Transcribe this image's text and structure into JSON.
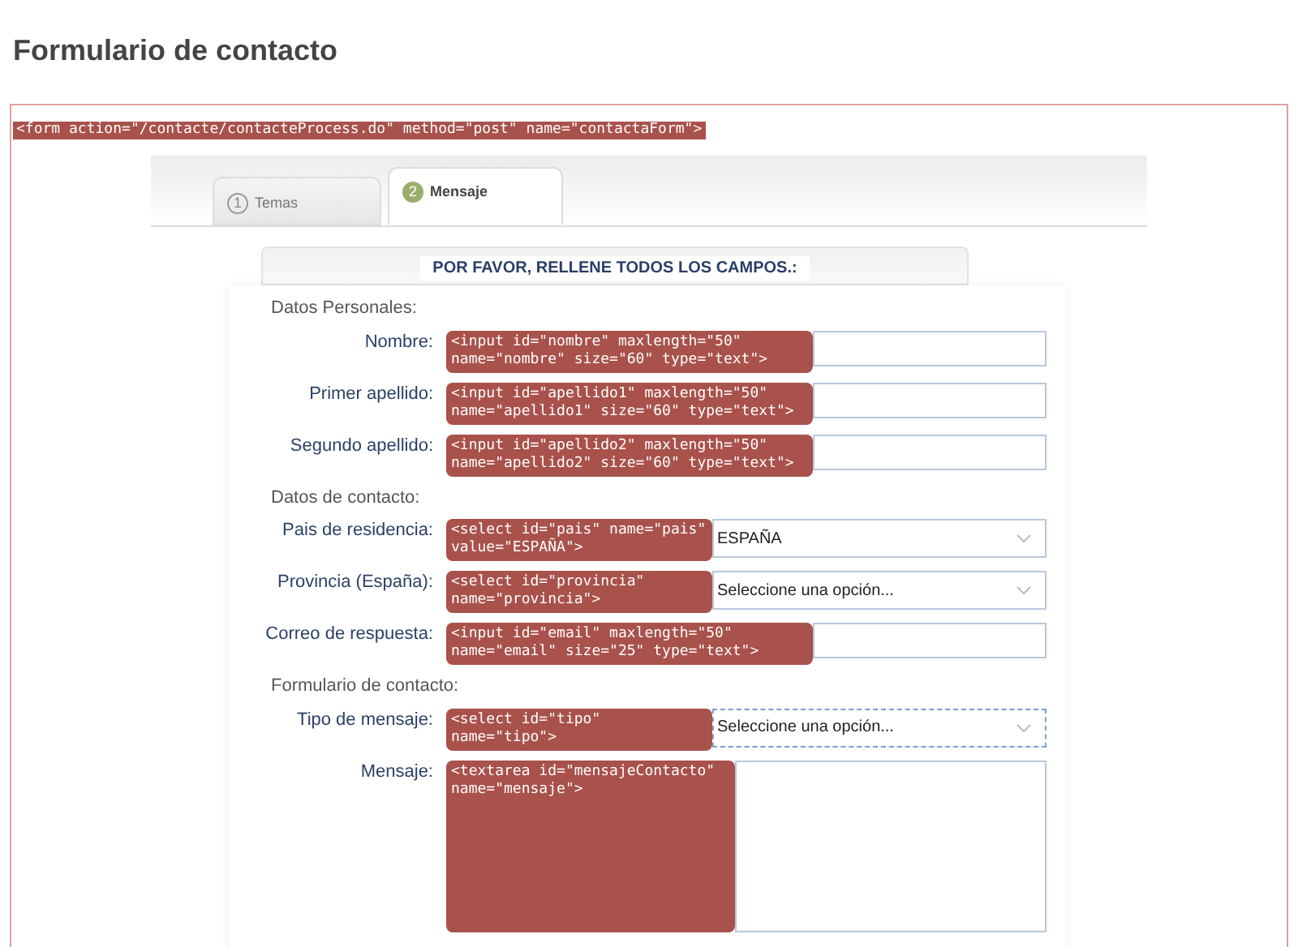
{
  "page_title": "Formulario de contacto",
  "form_tag": "<form action=\"/contacte/contacteProcess.do\" method=\"post\" name=\"contactaForm\">",
  "tabs": [
    {
      "number": "1",
      "label": "Temas",
      "selected": false
    },
    {
      "number": "2",
      "label": "Mensaje",
      "selected": true
    }
  ],
  "heading": "POR FAVOR, RELLENE TODOS LOS CAMPOS.:",
  "rows": [
    {
      "kind": "section",
      "label": "Datos Personales:"
    },
    {
      "kind": "input",
      "label": "Nombre:",
      "tag": "<input id=\"nombre\" maxlength=\"50\" name=\"nombre\" size=\"60\" type=\"text\">",
      "focused": false
    },
    {
      "kind": "input",
      "label": "Primer apellido:",
      "tag": "<input id=\"apellido1\" maxlength=\"50\" name=\"apellido1\" size=\"60\" type=\"text\">",
      "focused": false
    },
    {
      "kind": "input",
      "label": "Segundo apellido:",
      "tag": "<input id=\"apellido2\" maxlength=\"50\" name=\"apellido2\" size=\"60\" type=\"text\">",
      "focused": false
    },
    {
      "kind": "section",
      "label": "Datos de contacto:"
    },
    {
      "kind": "select",
      "label": "Pais de residencia:",
      "tag": "<select id=\"pais\" name=\"pais\" value=\"ESPAÑA\">",
      "value": "ESPAÑA",
      "focused": false
    },
    {
      "kind": "select",
      "label": "Provincia (España):",
      "tag": "<select id=\"provincia\" name=\"provincia\">",
      "value": "Seleccione una opción...",
      "focused": false
    },
    {
      "kind": "input",
      "label": "Correo de respuesta:",
      "tag": "<input id=\"email\" maxlength=\"50\" name=\"email\" size=\"25\" type=\"text\">",
      "focused": false
    },
    {
      "kind": "section",
      "label": "Formulario de contacto:"
    },
    {
      "kind": "select",
      "label": "Tipo de mensaje:",
      "tag": "<select id=\"tipo\" name=\"tipo\">",
      "value": "Seleccione una opción...",
      "focused": true
    },
    {
      "kind": "textarea",
      "label": "Mensaje:",
      "tag": "<textarea id=\"mensajeContacto\" name=\"mensaje\">",
      "focused": false
    }
  ]
}
